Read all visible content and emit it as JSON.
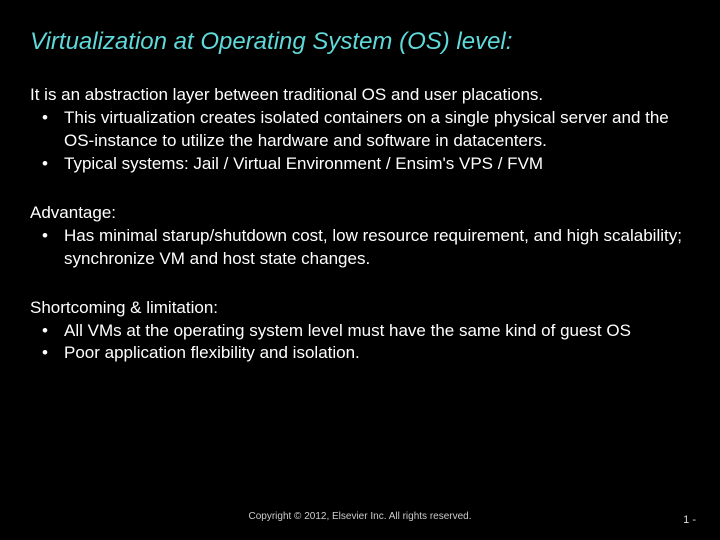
{
  "title": "Virtualization at Operating System (OS) level:",
  "intro": "It is an abstraction layer between traditional OS and user placations.",
  "bullets1": [
    "This virtualization creates isolated containers on a single physical server and the OS-instance to utilize the hardware and software in datacenters.",
    "Typical systems: Jail / Virtual Environment / Ensim's VPS / FVM"
  ],
  "advantage_label": "Advantage:",
  "advantage_bullets": [
    "Has minimal starup/shutdown cost, low resource requirement, and high scalability; synchronize VM and host state changes."
  ],
  "shortcoming_label": "Shortcoming & limitation:",
  "shortcoming_bullets": [
    "All VMs at the operating system level must have the same kind of guest OS",
    "Poor application flexibility and isolation."
  ],
  "copyright": "Copyright © 2012, Elsevier Inc. All rights reserved.",
  "page": "1 -"
}
